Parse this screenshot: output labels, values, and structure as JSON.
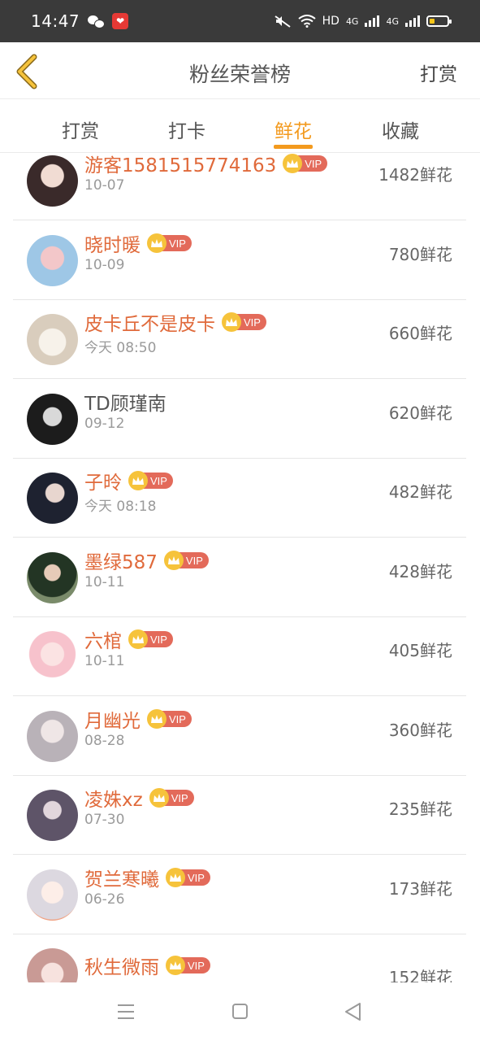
{
  "status_bar": {
    "time": "14:47",
    "app_badge_glyph": "❤",
    "network_label": "HD",
    "signal_label_1": "4G",
    "signal_label_2": "4G",
    "icons": [
      "wechat-icon",
      "app-notification-icon",
      "mute-icon",
      "wifi-icon",
      "signal-icon",
      "battery-icon"
    ]
  },
  "header": {
    "title": "粉丝荣誉榜",
    "right_action": "打赏",
    "back_icon": "chevron-left-icon",
    "accent_color": "#f39a1e"
  },
  "tabs": [
    {
      "label": "打赏",
      "active": false
    },
    {
      "label": "打卡",
      "active": false
    },
    {
      "label": "鲜花",
      "active": true
    },
    {
      "label": "收藏",
      "active": false
    }
  ],
  "fans": [
    {
      "name": "游客1581515774163",
      "date": "10-07",
      "flowers": "1482鲜花",
      "vip": true
    },
    {
      "name": "晓时暖",
      "date": "10-09",
      "flowers": "780鲜花",
      "vip": true
    },
    {
      "name": "皮卡丘不是皮卡",
      "date": "今天 08:50",
      "flowers": "660鲜花",
      "vip": true
    },
    {
      "name": "TD顾瑾南",
      "date": "09-12",
      "flowers": "620鲜花",
      "vip": false
    },
    {
      "name": "子昤",
      "date": "今天 08:18",
      "flowers": "482鲜花",
      "vip": true
    },
    {
      "name": "墨绿587",
      "date": "10-11",
      "flowers": "428鲜花",
      "vip": true
    },
    {
      "name": "六棺",
      "date": "10-11",
      "flowers": "405鲜花",
      "vip": true
    },
    {
      "name": "月幽光",
      "date": "08-28",
      "flowers": "360鲜花",
      "vip": true
    },
    {
      "name": "凌姝xz",
      "date": "07-30",
      "flowers": "235鲜花",
      "vip": true
    },
    {
      "name": "贺兰寒曦",
      "date": "06-26",
      "flowers": "173鲜花",
      "vip": true
    },
    {
      "name": "秋生微雨",
      "date": "",
      "flowers": "152鲜花",
      "vip": true
    }
  ],
  "vip_label": "VIP",
  "nav": {
    "icons": [
      "menu-icon",
      "home-square-icon",
      "back-triangle-icon"
    ]
  }
}
